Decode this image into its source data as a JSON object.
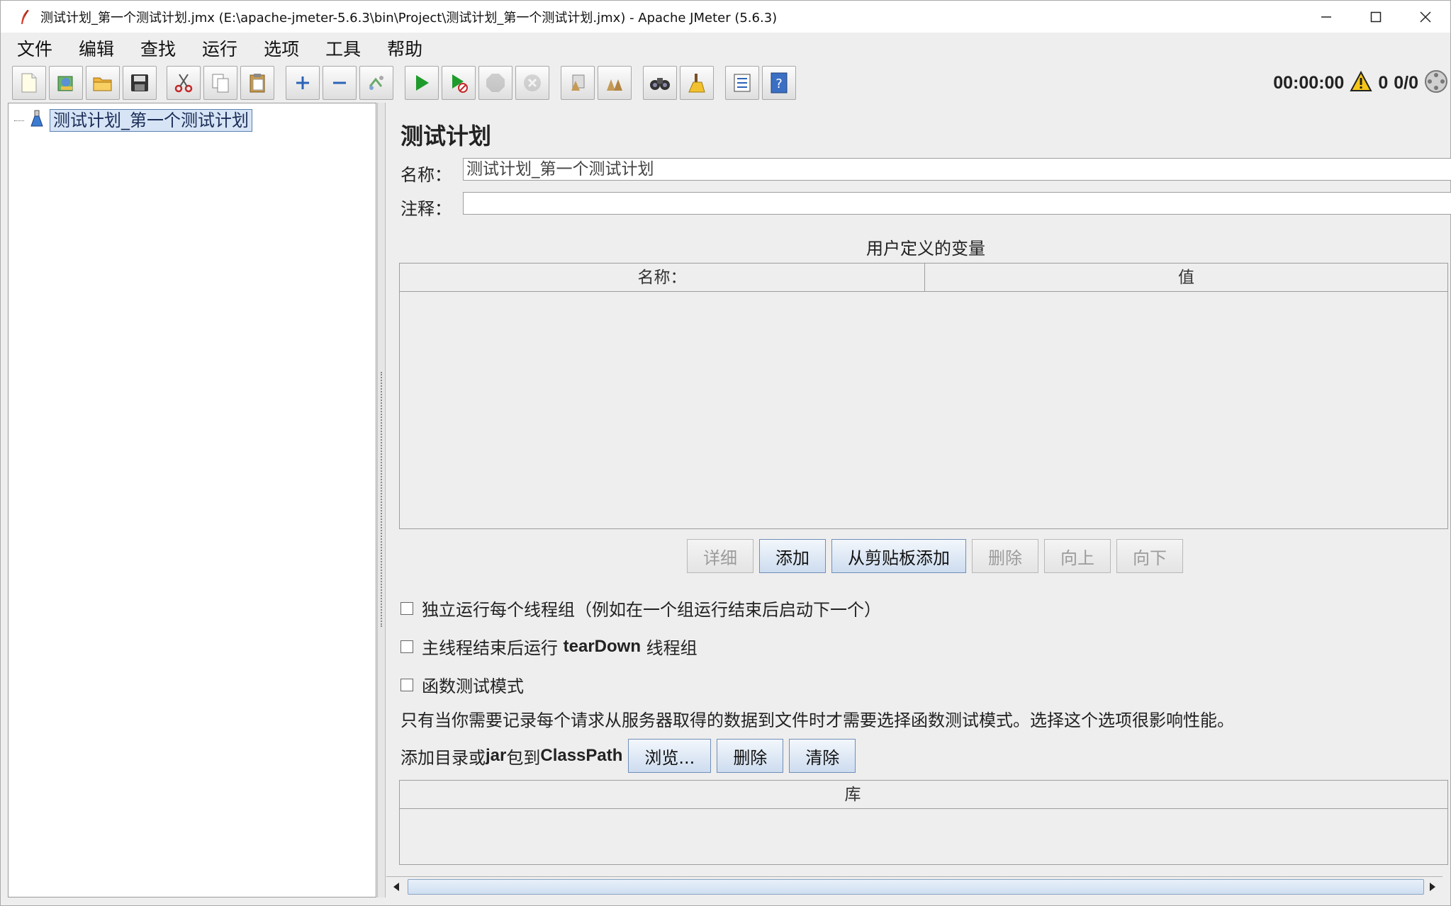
{
  "window": {
    "title": "测试计划_第一个测试计划.jmx (E:\\apache-jmeter-5.6.3\\bin\\Project\\测试计划_第一个测试计划.jmx) - Apache JMeter (5.6.3)"
  },
  "menu": [
    "文件",
    "编辑",
    "查找",
    "运行",
    "选项",
    "工具",
    "帮助"
  ],
  "toolbar": {
    "buttons": [
      "new-icon",
      "templates-icon",
      "open-icon",
      "save-icon",
      "cut-icon",
      "copy-icon",
      "paste-icon",
      "expand-icon",
      "collapse-icon",
      "toggle-icon",
      "start-icon",
      "start-no-pause-icon",
      "stop-icon",
      "shutdown-icon",
      "clear-icon",
      "clear-all-icon",
      "search-icon",
      "reset-search-icon",
      "function-helper-icon",
      "help-icon"
    ],
    "timer": "00:00:00",
    "warning_count": "0",
    "threads": "0/0"
  },
  "tree": {
    "root_label": "测试计划_第一个测试计划"
  },
  "panel": {
    "title": "测试计划",
    "name_label": "名称：",
    "name_value": "测试计划_第一个测试计划",
    "comment_label": "注释：",
    "comment_value": "",
    "variables_title": "用户定义的变量",
    "variables_columns": [
      "名称：",
      "值"
    ],
    "buttons": {
      "detail": "详细",
      "add": "添加",
      "add_clipboard": "从剪贴板添加",
      "delete": "删除",
      "up": "向上",
      "down": "向下"
    },
    "options": {
      "serialize_prefix": "独立运行每个线程组（例如在一个组运行结束后启动下一个）",
      "teardown_prefix": "主线程结束后运行 ",
      "teardown_bold": "tearDown",
      "teardown_suffix": " 线程组",
      "functional": "函数测试模式"
    },
    "functional_note": "只有当你需要记录每个请求从服务器取得的数据到文件时才需要选择函数测试模式。选择这个选项很影响性能。",
    "classpath": {
      "label_prefix": "添加目录或",
      "label_bold": "jar",
      "label_mid": "包到",
      "label_bold2": "ClassPath",
      "browse": "浏览...",
      "delete": "删除",
      "clear": "清除",
      "library_column": "库"
    }
  }
}
